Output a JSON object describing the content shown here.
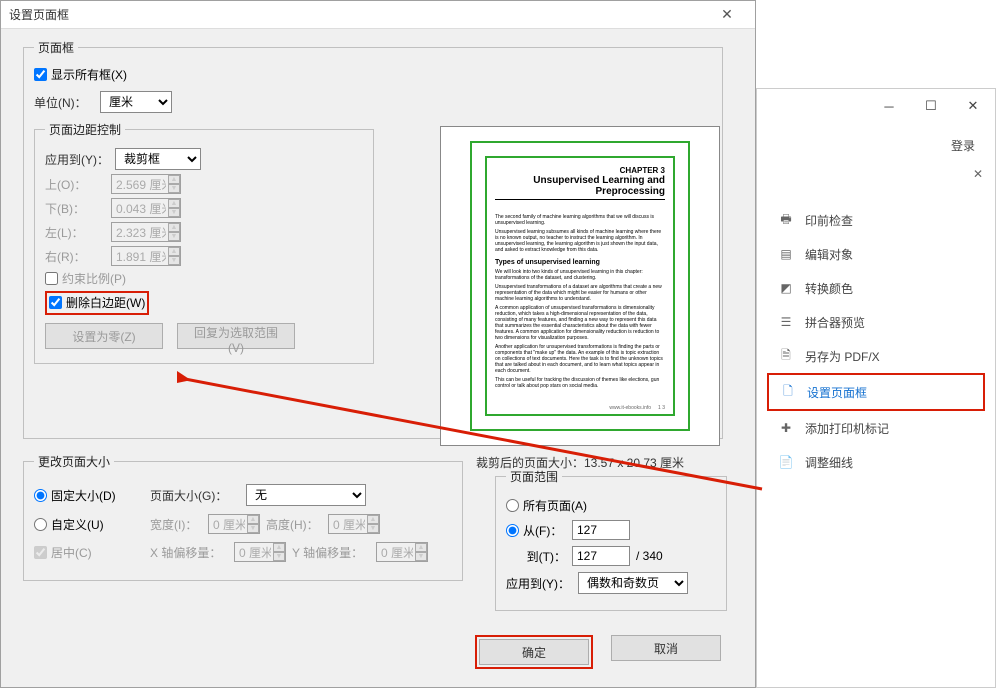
{
  "dialog": {
    "title": "设置页面框",
    "group_page": "页面框",
    "show_all_boxes": "显示所有框(X)",
    "unit_label": "单位(N)：",
    "unit_value": "厘米",
    "margin_group": "页面边距控制",
    "apply_to_label": "应用到(Y)：",
    "apply_to_value": "裁剪框",
    "top_label": "上(O)：",
    "top_value": "2.569 厘米",
    "bottom_label": "下(B)：",
    "bottom_value": "0.043 厘米",
    "left_label": "左(L)：",
    "left_value": "2.323 厘米",
    "right_label": "右(R)：",
    "right_value": "1.891 厘米",
    "constrain": "约束比例(P)",
    "remove_white": "删除白边距(W)",
    "set_zero": "设置为零(Z)",
    "revert": "回复为选取范围(V)",
    "preview_text": "裁剪后的页面大小：13.57 x 20.73 厘米",
    "preview_chapter": "CHAPTER 3",
    "preview_title": "Unsupervised Learning and Preprocessing",
    "preview_h2": "Types of unsupervised learning",
    "change_size_group": "更改页面大小",
    "fixed_size": "固定大小(D)",
    "custom_size": "自定义(U)",
    "center": "居中(C)",
    "page_size_label": "页面大小(G)：",
    "page_size_value": "无",
    "width_label": "宽度(I)：",
    "width_value": "0 厘米",
    "height_label": "高度(H)：",
    "height_value": "0 厘米",
    "xoff_label": "X 轴偏移量：",
    "xoff_value": "0 厘米",
    "yoff_label": "Y 轴偏移量：",
    "yoff_value": "0 厘米",
    "range_group": "页面范围",
    "all_pages": "所有页面(A)",
    "from_label": "从(F)：",
    "from_value": "127",
    "to_label": "到(T)：",
    "to_value": "127",
    "total": "/ 340",
    "range_apply_label": "应用到(Y)：",
    "range_apply_value": "偶数和奇数页",
    "ok": "确定",
    "cancel": "取消"
  },
  "panel": {
    "login": "登录",
    "items": {
      "preflight": "印前检查",
      "edit_obj": "编辑对象",
      "convert_color": "转换颜色",
      "flattener": "拼合器预览",
      "save_as_pdfx": "另存为 PDF/X",
      "set_page_boxes": "设置页面框",
      "add_printer_marks": "添加打印机标记",
      "fix_hairlines": "调整细线"
    }
  }
}
